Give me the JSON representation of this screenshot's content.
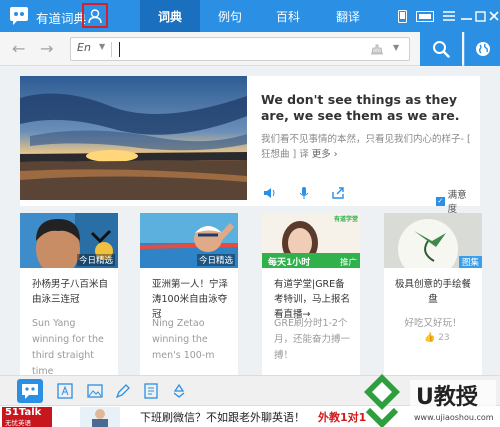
{
  "app": {
    "title": "有道词典"
  },
  "nav": {
    "tabs": [
      "词典",
      "例句",
      "百科",
      "翻译"
    ],
    "active": 0
  },
  "search": {
    "lang": "En",
    "value": "",
    "placeholder": ""
  },
  "hero": {
    "quote": "We don't see things as they are, we see them as we are.",
    "translation": "我们看不见事情的本然，只看见我们内心的样子- [ 狂想曲 ] 译",
    "more": "更多 ›",
    "satisfaction": "满意度"
  },
  "cards": [
    {
      "badge": "今日精选",
      "title": "孙杨男子八百米自由泳三连冠",
      "subtitle": "Sun Yang winning for the third straight time"
    },
    {
      "badge": "今日精选",
      "title": "亚洲第一人！宁泽涛100米自由泳夺冠",
      "subtitle": "Ning Zetao winning the men's 100-m"
    },
    {
      "badge": "推广",
      "img_banner": "有道学堂",
      "img_text": "每天1小时",
      "title": "有道学堂|GRE备考特训，马上报名看直播→",
      "subtitle": "GRE刷分时1-2个月，还能奋力搏一搏！"
    },
    {
      "badge": "图集",
      "title": "极具创意的手绘餐盘",
      "subtitle": "好吃又好玩！",
      "likes": "23"
    }
  ],
  "ad": {
    "brand": "51Talk",
    "brand_sub": "无忧英语",
    "text": "下班刷微信？不如跟老外聊英语！",
    "highlight": "外教1对1"
  },
  "watermark": {
    "text": "U教授",
    "url": "www.ujiaoshou.com"
  },
  "colors": {
    "accent": "#2b8fe3",
    "accent_dark": "#1a6fbf",
    "highlight_border": "#d8202a",
    "ad_red": "#c8161d"
  }
}
